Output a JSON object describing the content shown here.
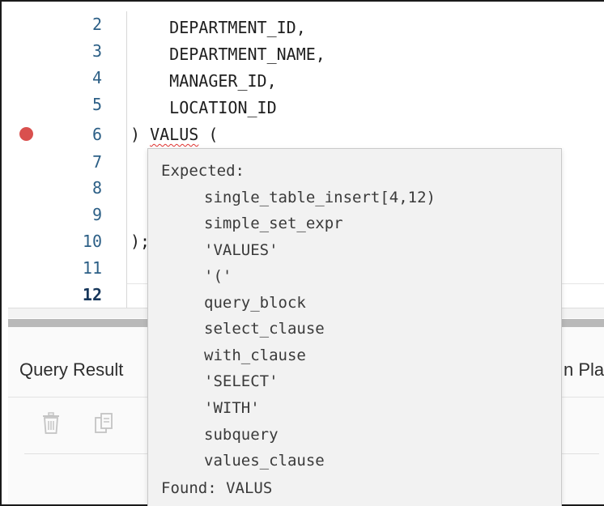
{
  "editor": {
    "lines": [
      {
        "number": "2",
        "text": "    DEPARTMENT_ID,"
      },
      {
        "number": "3",
        "text": "    DEPARTMENT_NAME,"
      },
      {
        "number": "4",
        "text": "    MANAGER_ID,"
      },
      {
        "number": "5",
        "text": "    LOCATION_ID"
      },
      {
        "number": "6",
        "prefix": ") ",
        "error_word": "VALUS",
        "suffix": " (",
        "breakpoint": true
      },
      {
        "number": "7",
        "text": ""
      },
      {
        "number": "8",
        "text": ""
      },
      {
        "number": "9",
        "text": ""
      },
      {
        "number": "10",
        "text": ");"
      },
      {
        "number": "11",
        "text": ""
      },
      {
        "number": "12",
        "text": "",
        "current": true
      }
    ],
    "breakpoint_color": "#d9504e",
    "line_number_color": "#2c5f86",
    "error_underline_color": "#e0322f"
  },
  "tooltip": {
    "header": "Expected:",
    "items": [
      "single_table_insert[4,12)",
      "simple_set_expr",
      "'VALUES'",
      "'('",
      "query_block",
      "select_clause",
      "with_clause",
      "'SELECT'",
      "'WITH'",
      "subquery",
      "values_clause"
    ],
    "found": "Found: VALUS"
  },
  "bottom_panel": {
    "tabs": [
      "Query Result",
      "n Pla"
    ],
    "toolbar": {
      "delete_icon": "trash-icon",
      "copy_icon": "copy-icon"
    }
  }
}
